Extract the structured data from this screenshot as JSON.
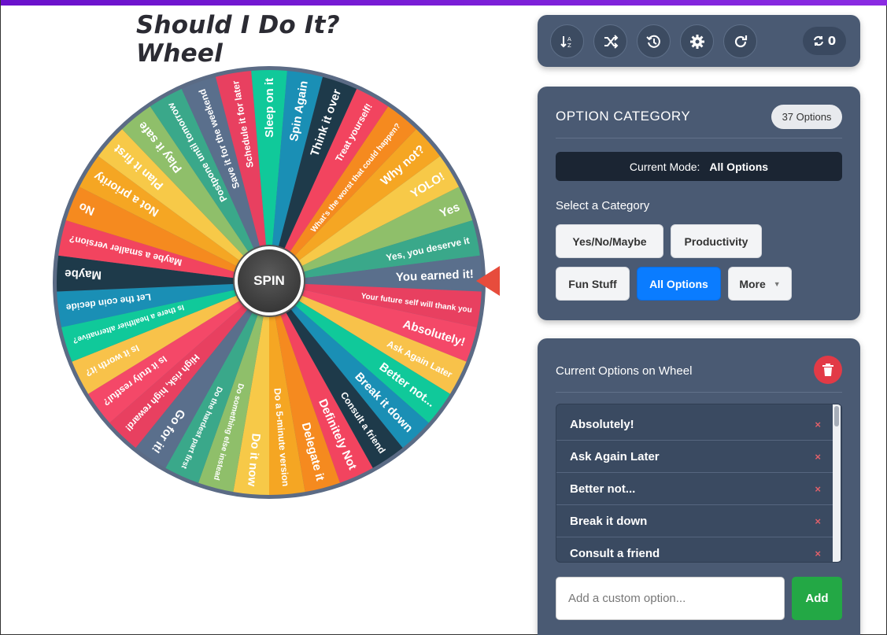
{
  "title": "Should I Do It? Wheel",
  "spin_label": "SPIN",
  "wheel_segments": [
    "Sleep on it",
    "Spin Again",
    "Think it over",
    "Treat yourself!",
    "What's the worst that could happen?",
    "Why not?",
    "YOLO!",
    "Yes",
    "Yes, you deserve it",
    "You earned it!",
    "Your future self will thank you",
    "Absolutely!",
    "Ask Again Later",
    "Better not...",
    "Break it down",
    "Consult a friend",
    "Definitely Not",
    "Delegate it",
    "Do a 5-minute version",
    "Do it now",
    "Do something else instead",
    "Do the hardest part first",
    "Go for it!",
    "High risk, high reward!",
    "Is it truly restful?",
    "Is it worth it?",
    "Is there a healthier alternative?",
    "Let the coin decide",
    "Maybe",
    "Maybe a smaller version?",
    "No",
    "Not a priority",
    "Plan it first",
    "Play it safe",
    "Postpone until tomorrow",
    "Save it for the weekend",
    "Schedule it for later"
  ],
  "wheel_colors": [
    "#10c99a",
    "#1a8fb5",
    "#1e3a4a",
    "#f2445f",
    "#f58a1f",
    "#f5a623",
    "#f7c948",
    "#8fbf6a",
    "#3aa88a",
    "#5a6f8c",
    "#e84060",
    "#f44868",
    "#f8c24a"
  ],
  "toolbar": {
    "icons": [
      "sort-icon",
      "shuffle-icon",
      "history-icon",
      "settings-icon",
      "reset-icon"
    ],
    "spin_count": "0"
  },
  "category": {
    "heading": "OPTION CATEGORY",
    "count_badge": "37 Options",
    "mode_label": "Current Mode:",
    "mode_value": "All Options",
    "select_label": "Select a Category",
    "chips": [
      "Yes/No/Maybe",
      "Productivity",
      "Fun Stuff",
      "All Options",
      "More"
    ]
  },
  "options": {
    "heading": "Current Options on Wheel",
    "items": [
      "Absolutely!",
      "Ask Again Later",
      "Better not...",
      "Break it down",
      "Consult a friend"
    ],
    "remove_glyph": "×",
    "input_placeholder": "Add a custom option...",
    "add_label": "Add"
  }
}
